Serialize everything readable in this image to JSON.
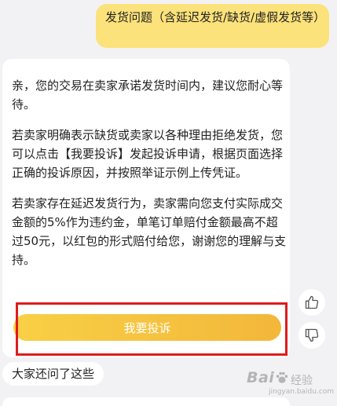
{
  "user_message": {
    "text": "发货问题（含延迟发货/缺货/虚假发货等）"
  },
  "bot_reply": {
    "paragraphs": [
      "亲，您的交易在卖家承诺发货时间内，建议您耐心等待。",
      "若卖家明确表示缺货或卖家以各种理由拒绝发货，您可以点击【我要投诉】发起投诉申请，根据页面选择正确的投诉原因，并按照举证示例上传凭证。",
      "若卖家存在延迟发货行为，卖家需向您支付实际成交金额的5%作为违约金，单笔订单赔付金额最高不超过50元，以红包的形式赔付给您，谢谢您的理解与支持。"
    ],
    "action_button": "我要投诉"
  },
  "feedback": {
    "up_icon": "thumbs-up-icon",
    "down_icon": "thumbs-down-icon"
  },
  "related": {
    "label": "大家还问了这些"
  },
  "watermark": {
    "brand": "Bai",
    "brand_suffix": "经验",
    "url": "jingyan.baidu.com"
  },
  "colors": {
    "user_bubble": "#fbe27a",
    "button_start": "#f8d046",
    "button_end": "#f3b73a",
    "highlight": "#e01b1b",
    "background": "#f2f2f4"
  }
}
